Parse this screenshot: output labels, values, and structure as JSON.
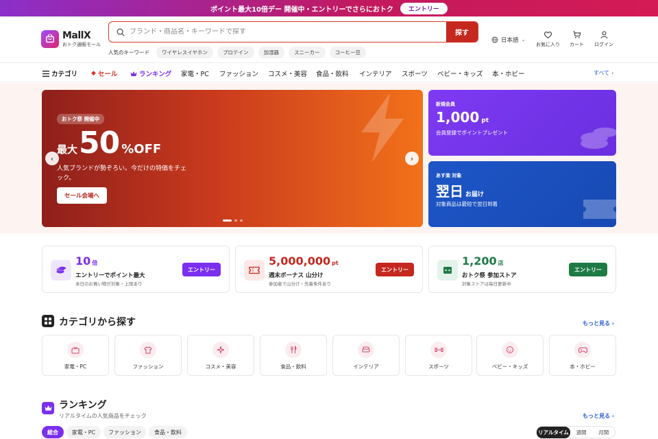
{
  "promo": {
    "text": "ポイント最大10倍デー 開催中・エントリーでさらにおトク",
    "entry_label": "エントリー"
  },
  "header": {
    "logo_name": "MallX",
    "logo_sub": "おトク通販モール",
    "search_placeholder": "ブランド・商品名・キーワードで探す",
    "search_button": "探す",
    "keywords_label": "人気のキーワード",
    "keywords": [
      "ワイヤレスイヤホン",
      "プロテイン",
      "加湿器",
      "スニーカー",
      "コーヒー豆"
    ],
    "language": "日本語",
    "icons": {
      "favorites": "お気に入り",
      "cart": "カート",
      "login": "ログイン"
    }
  },
  "nav": {
    "category": "カテゴリ",
    "sale": "セール",
    "ranking": "ランキング",
    "items": [
      "家電・PC",
      "ファッション",
      "コスメ・美容",
      "食品・飲料",
      "インテリア",
      "スポーツ",
      "ベビー・キッズ",
      "本・ホビー"
    ],
    "all": "すべて"
  },
  "hero": {
    "badge": "おトク祭 開催中",
    "pre": "最大",
    "number": "50",
    "off": "%OFF",
    "desc": "人気ブランドが勢ぞろい。今だけの特価をチェック。",
    "cta": "セール会場へ",
    "slide_count": 3,
    "active_slide": 1
  },
  "side_banners": [
    {
      "tag": "新規会員",
      "value": "1,000",
      "unit": "pt",
      "sub": "会員登録でポイントプレゼント",
      "color": "#7e3af2"
    },
    {
      "tag": "あす楽 対象",
      "value": "翌日",
      "unit": "お届け",
      "sub": "対象商品は最短で翌日到着",
      "color": "#1e56c7"
    }
  ],
  "campaigns": [
    {
      "value": "10",
      "unit": "倍",
      "title": "エントリーでポイント最大",
      "sub": "本日のお買い物が対象・上限あり",
      "button": "エントリー",
      "color": "#7b2ff0",
      "icon": "coins-icon"
    },
    {
      "value": "5,000,000",
      "unit": "pt",
      "title": "週末ボーナス 山分け",
      "sub": "参加者で山分け・先着条件あり",
      "button": "エントリー",
      "color": "#c4281f",
      "icon": "ticket-icon"
    },
    {
      "value": "1,200",
      "unit": "店",
      "title": "おトク祭 参加ストア",
      "sub": "対象ストアは毎日更新中",
      "button": "エントリー",
      "color": "#1e7a45",
      "icon": "store-icon"
    }
  ],
  "categories_section": {
    "title": "カテゴリから探す",
    "more": "もっと見る",
    "tiles": [
      {
        "label": "家電・PC",
        "icon": "tv-icon"
      },
      {
        "label": "ファッション",
        "icon": "shirt-icon"
      },
      {
        "label": "コスメ・美容",
        "icon": "sparkle-icon"
      },
      {
        "label": "食品・飲料",
        "icon": "utensils-icon"
      },
      {
        "label": "インテリア",
        "icon": "sofa-icon"
      },
      {
        "label": "スポーツ",
        "icon": "dumbbell-icon"
      },
      {
        "label": "ベビー・キッズ",
        "icon": "baby-icon"
      },
      {
        "label": "本・ホビー",
        "icon": "gamepad-icon"
      }
    ]
  },
  "ranking": {
    "title": "ランキング",
    "sub": "リアルタイムの人気商品をチェック",
    "more": "もっと見る",
    "tabs": [
      "総合",
      "家電・PC",
      "ファッション",
      "食品・飲料"
    ],
    "active_tab": "総合",
    "periods": [
      "リアルタイム",
      "週間",
      "月間"
    ],
    "active_period": "リアルタイム"
  }
}
